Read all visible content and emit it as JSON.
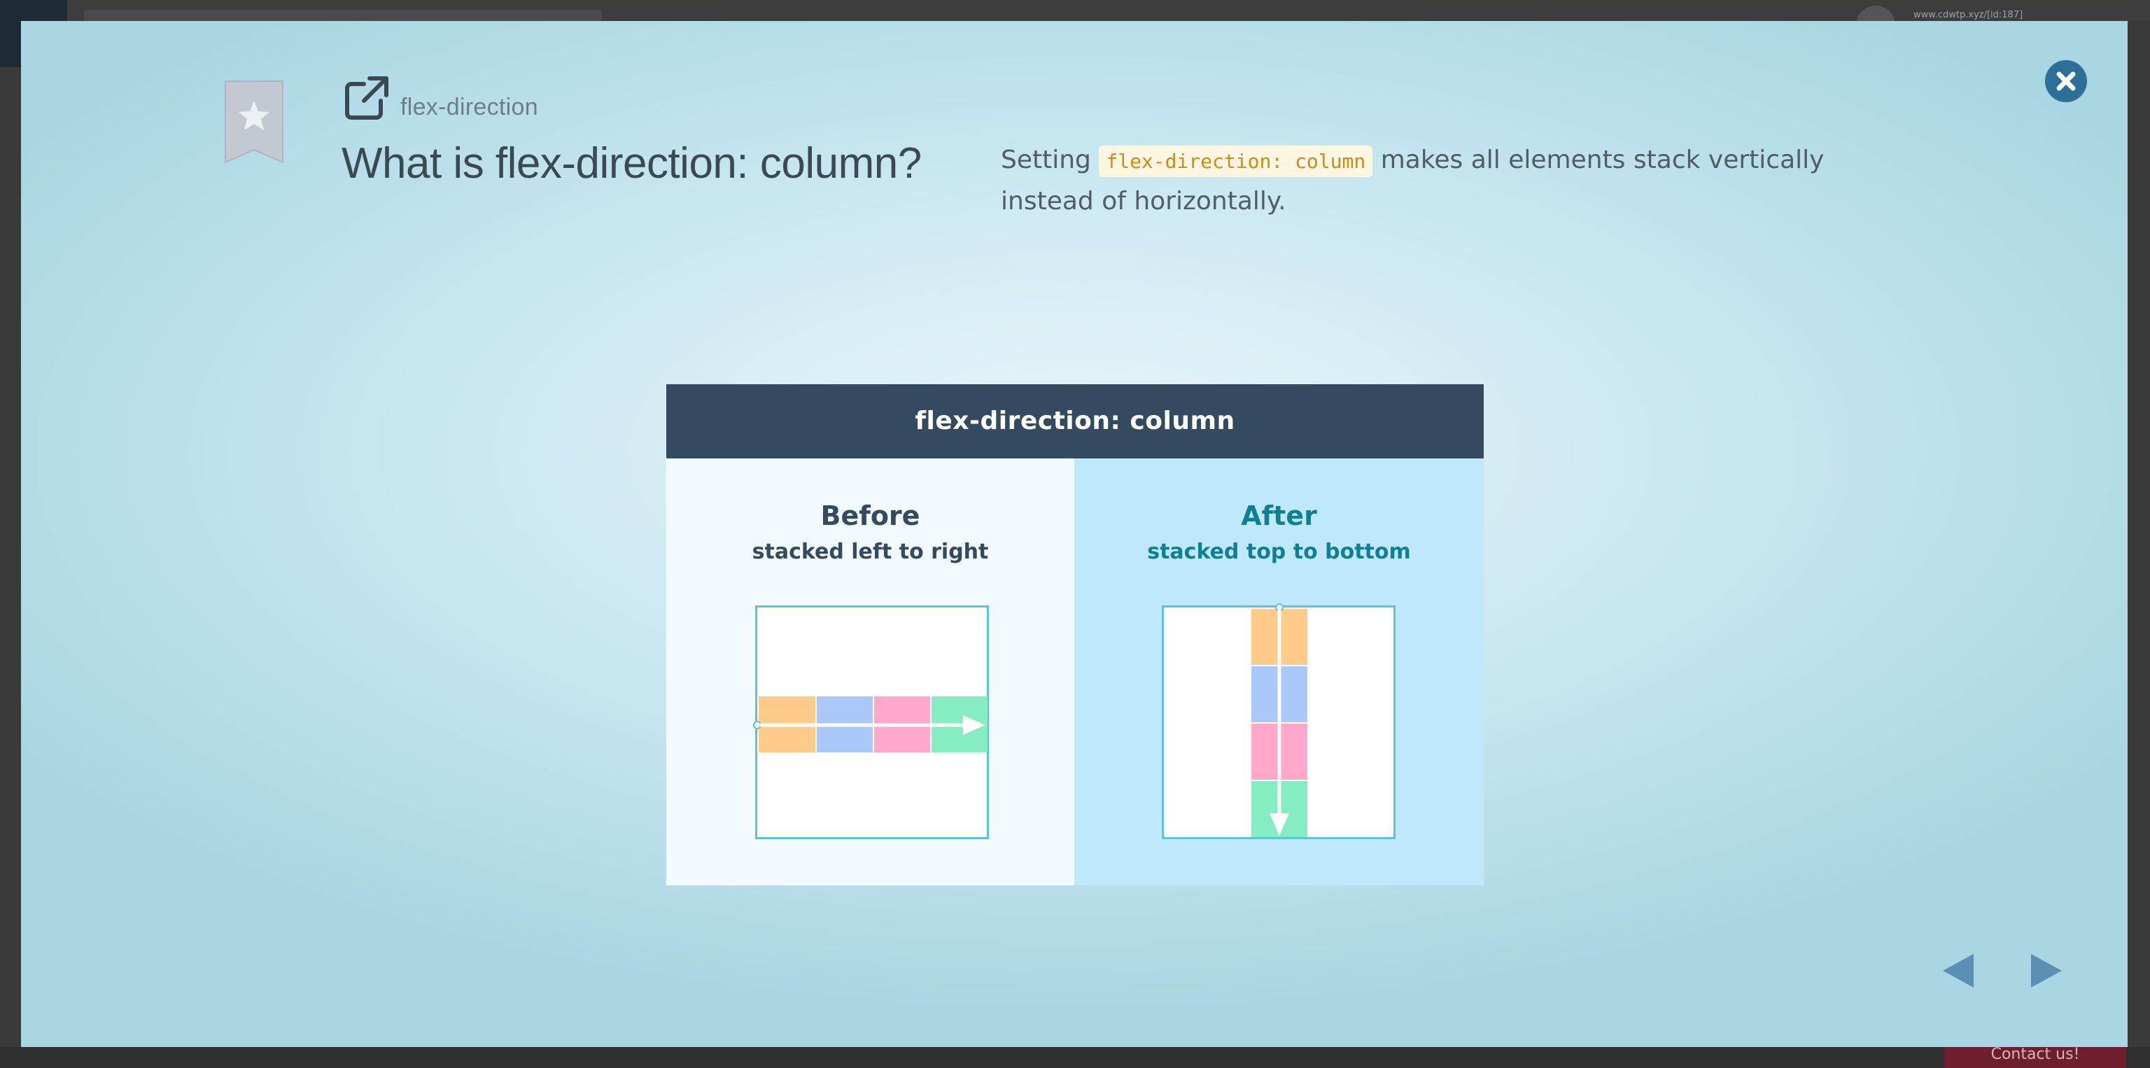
{
  "background_page": {
    "url_text": "www.cdwtp.xyz/[id:187]",
    "contact_label": "Contact us!"
  },
  "modal": {
    "topic_label": "flex-direction",
    "title": "What is flex-direction: column?",
    "description": {
      "prefix": "Setting",
      "code": "flex-direction: column",
      "suffix": "makes all elements stack vertically instead of horizontally."
    },
    "icons": {
      "bookmark": "bookmark-star-icon",
      "external": "external-link-icon",
      "close": "close-icon",
      "prev": "arrow-left-icon",
      "next": "arrow-right-icon"
    },
    "figure": {
      "header": "flex-direction: column",
      "before": {
        "title": "Before",
        "subtitle": "stacked left to right"
      },
      "after": {
        "title": "After",
        "subtitle": "stacked top to bottom"
      },
      "item_colors": [
        "#ffcb8a",
        "#aac8fa",
        "#ffa8cb",
        "#86ecc1"
      ]
    }
  },
  "colors": {
    "accent": "#2e6f9a",
    "figure_header": "#344a60",
    "after_panel": "#bfe8fb",
    "code_text": "#d28b12"
  }
}
